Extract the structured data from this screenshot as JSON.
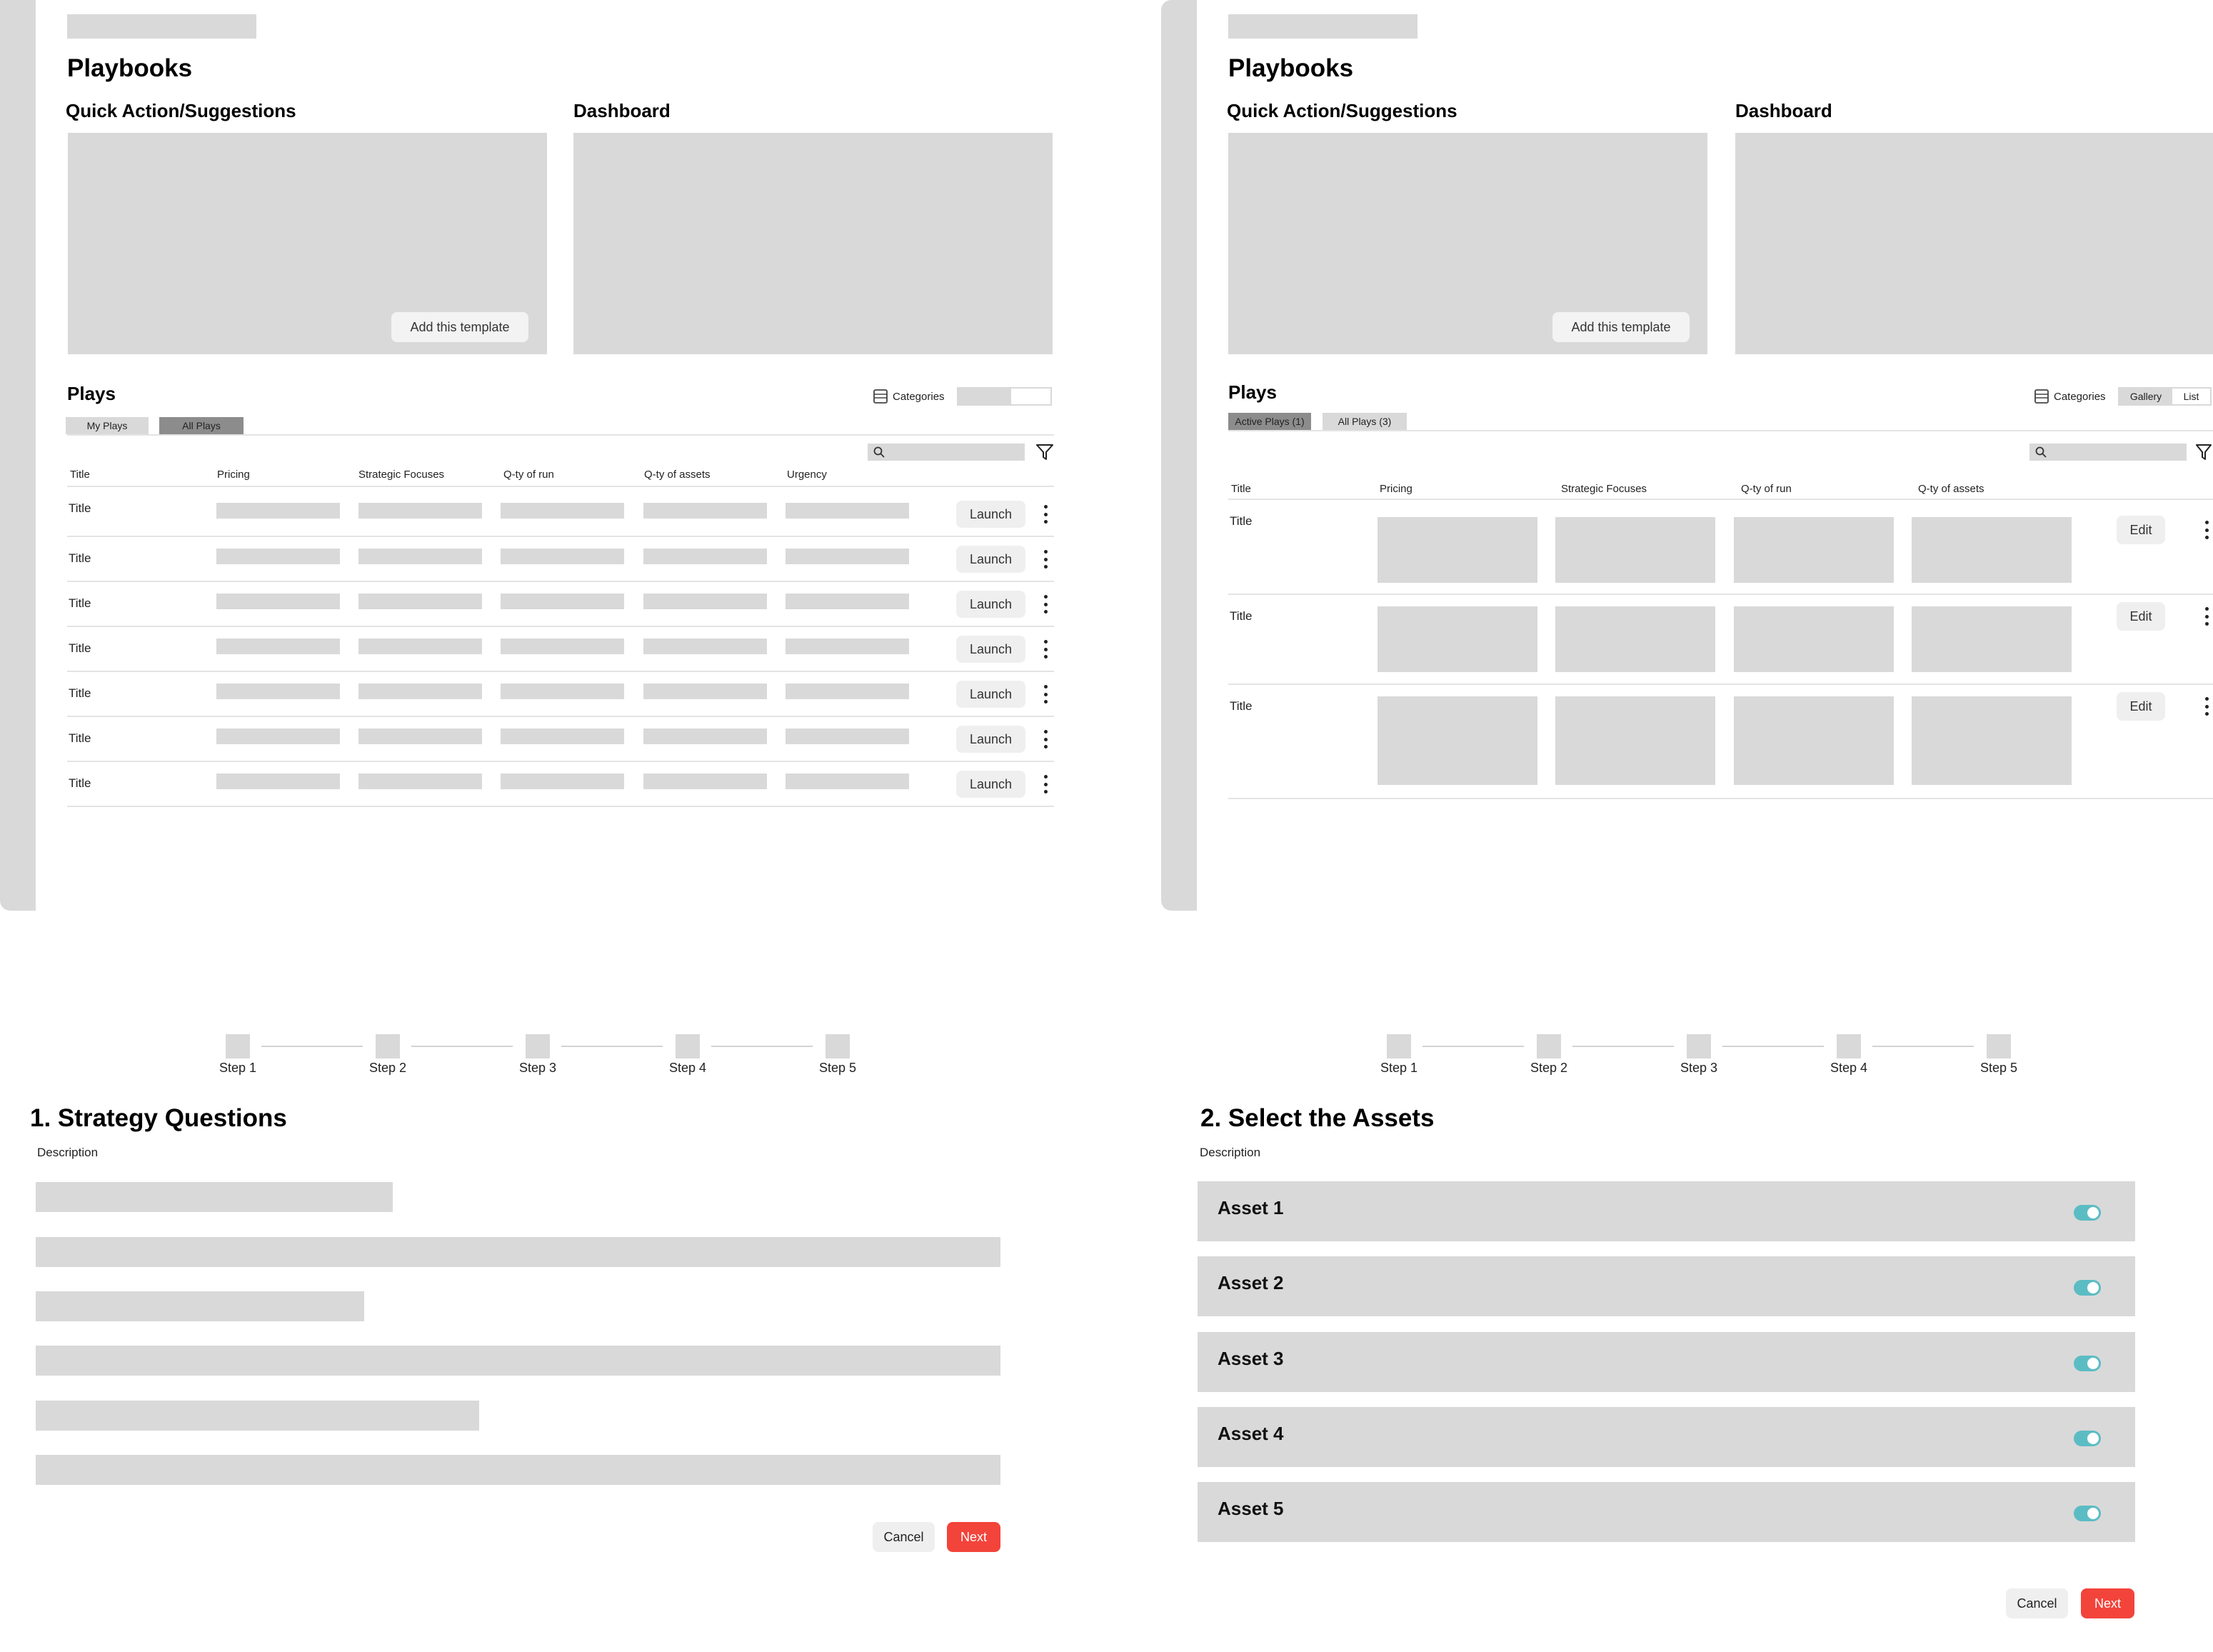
{
  "screen1": {
    "page_title": "Playbooks",
    "quick_action_title": "Quick Action/Suggestions",
    "dashboard_title": "Dashboard",
    "add_template_label": "Add this template",
    "plays_title": "Plays",
    "categories_label": "Categories",
    "tabs": [
      "My Plays",
      "All Plays"
    ],
    "columns": [
      "Title",
      "Pricing",
      "Strategic Focuses",
      "Q-ty of run",
      "Q-ty of assets",
      "Urgency"
    ],
    "row_title": "Title",
    "row_action": "Launch",
    "row_count": 7
  },
  "screen2": {
    "page_title": "Playbooks",
    "quick_action_title": "Quick Action/Suggestions",
    "dashboard_title": "Dashboard",
    "add_template_label": "Add this template",
    "plays_title": "Plays",
    "categories_label": "Categories",
    "view_toggle": [
      "Gallery",
      "List"
    ],
    "tabs": [
      "Active Plays (1)",
      "All Plays (3)"
    ],
    "columns": [
      "Title",
      "Pricing",
      "Strategic Focuses",
      "Q-ty of run",
      "Q-ty of assets"
    ],
    "row_title": "Title",
    "row_action": "Edit",
    "row_count": 3
  },
  "wizard1": {
    "steps": [
      "Step 1",
      "Step 2",
      "Step 3",
      "Step 4",
      "Step 5"
    ],
    "title": "1. Strategy Questions",
    "description": "Description",
    "cancel_label": "Cancel",
    "next_label": "Next"
  },
  "wizard2": {
    "steps": [
      "Step 1",
      "Step 2",
      "Step 3",
      "Step 4",
      "Step 5"
    ],
    "title": "2. Select the Assets",
    "description": "Description",
    "assets": [
      {
        "name": "Asset 1",
        "enabled": true
      },
      {
        "name": "Asset 2",
        "enabled": true
      },
      {
        "name": "Asset 3",
        "enabled": true
      },
      {
        "name": "Asset 4",
        "enabled": true
      },
      {
        "name": "Asset 5",
        "enabled": true
      }
    ],
    "cancel_label": "Cancel",
    "next_label": "Next"
  },
  "colors": {
    "placeholder": "#d9d9d9",
    "toggle_on": "#5cbcc4",
    "primary_button": "#f2443b",
    "active_tab": "#8c8c8c"
  },
  "icons": [
    "kebab-menu-icon",
    "search-icon",
    "filter-icon",
    "categories-icon"
  ]
}
